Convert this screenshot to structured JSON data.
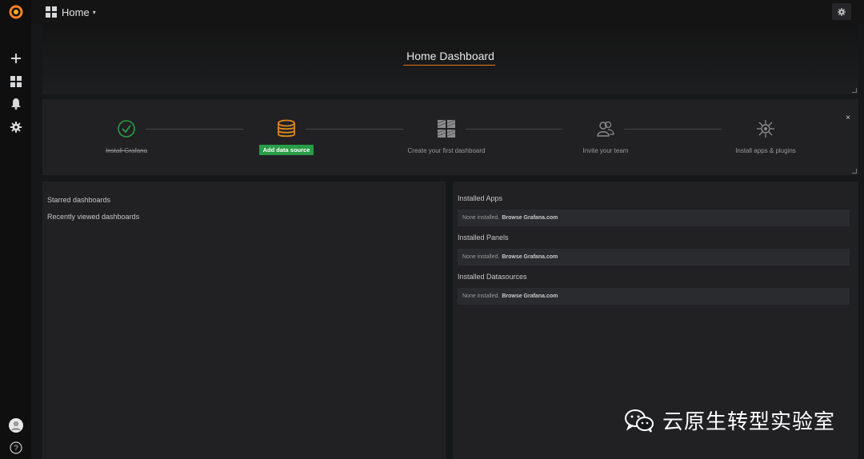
{
  "nav": {
    "home_label": "Home",
    "caret": "▾"
  },
  "sidebar": {
    "items": [
      "plus-icon",
      "dashboards-icon",
      "alerting-bell-icon",
      "configuration-gear-icon"
    ],
    "bottom": [
      "user-avatar",
      "help-icon"
    ],
    "help_glyph": "?"
  },
  "dashboard": {
    "title": "Home Dashboard"
  },
  "getting_started": {
    "close_glyph": "×",
    "steps": [
      {
        "label": "Install Grafana",
        "status": "done",
        "icon": "check-circle-icon"
      },
      {
        "label": "Add data source",
        "status": "active",
        "icon": "database-icon"
      },
      {
        "label": "Create your first dashboard",
        "status": "todo",
        "icon": "dashboard-grid-icon"
      },
      {
        "label": "Invite your team",
        "status": "todo",
        "icon": "users-icon"
      },
      {
        "label": "Install apps & plugins",
        "status": "todo",
        "icon": "plugin-icon"
      }
    ]
  },
  "left_panel": {
    "starred": "Starred dashboards",
    "recent": "Recently viewed dashboards"
  },
  "right_panel": {
    "sections": [
      {
        "title": "Installed Apps",
        "none_text": "None installed.",
        "browse_text": "Browse Grafana.com"
      },
      {
        "title": "Installed Panels",
        "none_text": "None installed.",
        "browse_text": "Browse Grafana.com"
      },
      {
        "title": "Installed Datasources",
        "none_text": "None installed.",
        "browse_text": "Browse Grafana.com"
      }
    ]
  },
  "watermark": {
    "text": "云原生转型实验室"
  },
  "colors": {
    "accent_orange": "#eb7b18",
    "success_green": "#299c46",
    "check_green": "#299c46",
    "database_orange": "#e0891e"
  }
}
